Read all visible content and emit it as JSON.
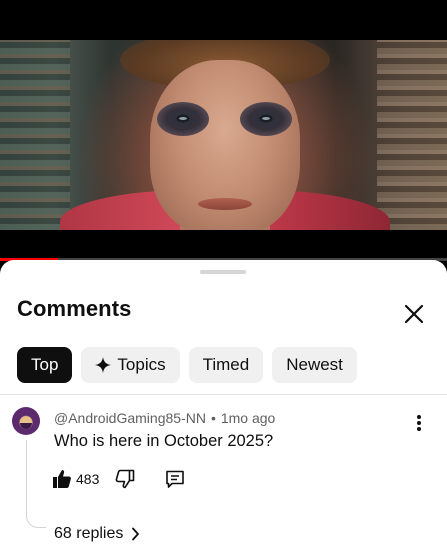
{
  "video": {
    "progress_fraction": 0.13
  },
  "comments_panel": {
    "title": "Comments",
    "close_icon": "close-icon",
    "filters": [
      {
        "label": "Top",
        "active": true
      },
      {
        "label": "Topics",
        "icon": "sparkle-icon",
        "active": false
      },
      {
        "label": "Timed",
        "active": false
      },
      {
        "label": "Newest",
        "active": false
      }
    ],
    "comment": {
      "author": "@AndroidGaming85-NN",
      "separator": "•",
      "time": "1mo ago",
      "text": "Who is here in October 2025?",
      "likes": "483",
      "replies_label": "68 replies",
      "icons": [
        "thumbs-up-icon",
        "thumbs-down-icon",
        "reply-icon",
        "more-vert-icon",
        "chevron-right-icon"
      ]
    }
  },
  "colors": {
    "accent": "#ff0000",
    "chip_active_bg": "#0f0f0f",
    "chip_bg": "#f0f0f0",
    "secondary_text": "#606060"
  }
}
